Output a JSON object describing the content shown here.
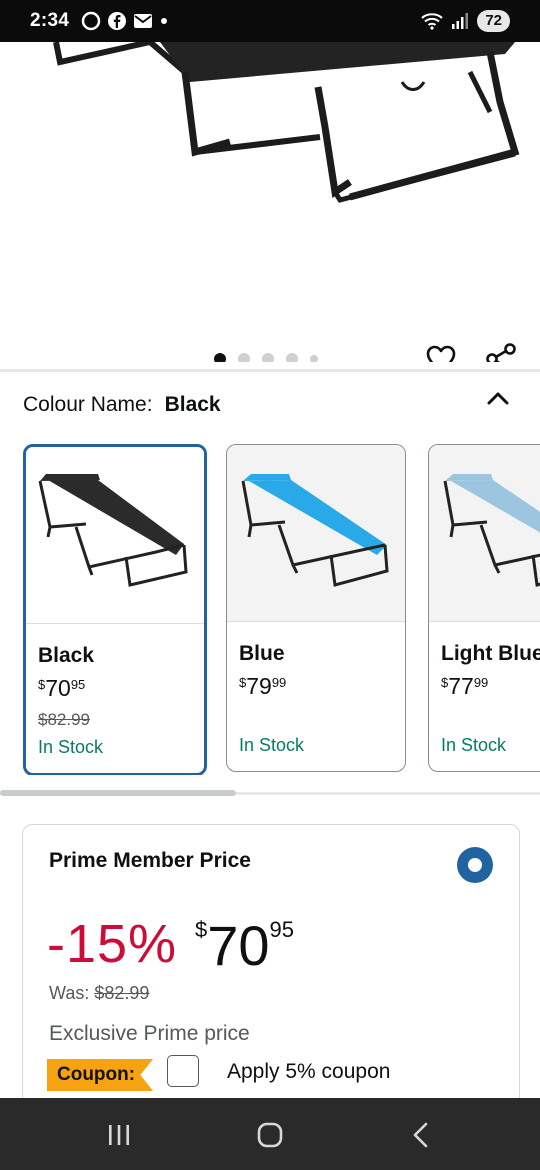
{
  "status_bar": {
    "time": "2:34",
    "battery": "72",
    "notification_icons": [
      "circle-icon",
      "facebook-icon",
      "mail-icon",
      "dot-icon"
    ]
  },
  "product_gallery": {
    "image_count": 5,
    "active_index": 0
  },
  "colour_selector": {
    "label": "Colour Name:",
    "selected": "Black",
    "options": [
      {
        "name": "Black",
        "price_currency": "$",
        "price_whole": "70",
        "price_cents": "95",
        "was": "$82.99",
        "stock": "In Stock",
        "frame_color": "#222222",
        "fabric_color": "#2b2b2b",
        "selected": true
      },
      {
        "name": "Blue",
        "price_currency": "$",
        "price_whole": "79",
        "price_cents": "99",
        "was": "",
        "stock": "In Stock",
        "frame_color": "#222222",
        "fabric_color": "#2aa9e8",
        "selected": false
      },
      {
        "name": "Light Blue",
        "price_currency": "$",
        "price_whole": "77",
        "price_cents": "99",
        "was": "",
        "stock": "In Stock",
        "frame_color": "#222222",
        "fabric_color": "#9cc6e0",
        "selected": false
      }
    ]
  },
  "prime_offer": {
    "title": "Prime Member Price",
    "discount": "-15%",
    "price_currency": "$",
    "price_whole": "70",
    "price_cents": "95",
    "was_label": "Was:",
    "was_price": "$82.99",
    "exclusive_text": "Exclusive Prime price",
    "coupon_label": "Coupon:",
    "coupon_text": "Apply 5% coupon",
    "selected": true
  },
  "colors": {
    "accent_blue": "#2162a1",
    "deal_red": "#cc0c39",
    "stock_green": "#067d62",
    "coupon_orange": "#f7a211"
  }
}
